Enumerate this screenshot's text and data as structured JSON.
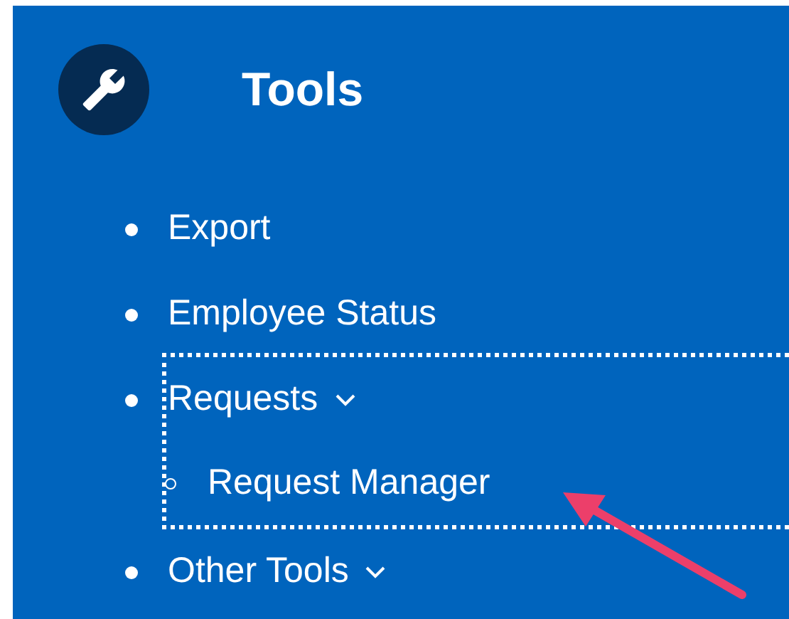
{
  "panel": {
    "title": "Tools",
    "items": [
      {
        "label": "Export",
        "has_submenu": false,
        "focused": false
      },
      {
        "label": "Employee Status",
        "has_submenu": false,
        "focused": false
      },
      {
        "label": "Requests",
        "has_submenu": true,
        "focused": true,
        "children": [
          {
            "label": "Request Manager"
          }
        ]
      },
      {
        "label": "Other Tools",
        "has_submenu": true,
        "focused": false
      }
    ]
  }
}
